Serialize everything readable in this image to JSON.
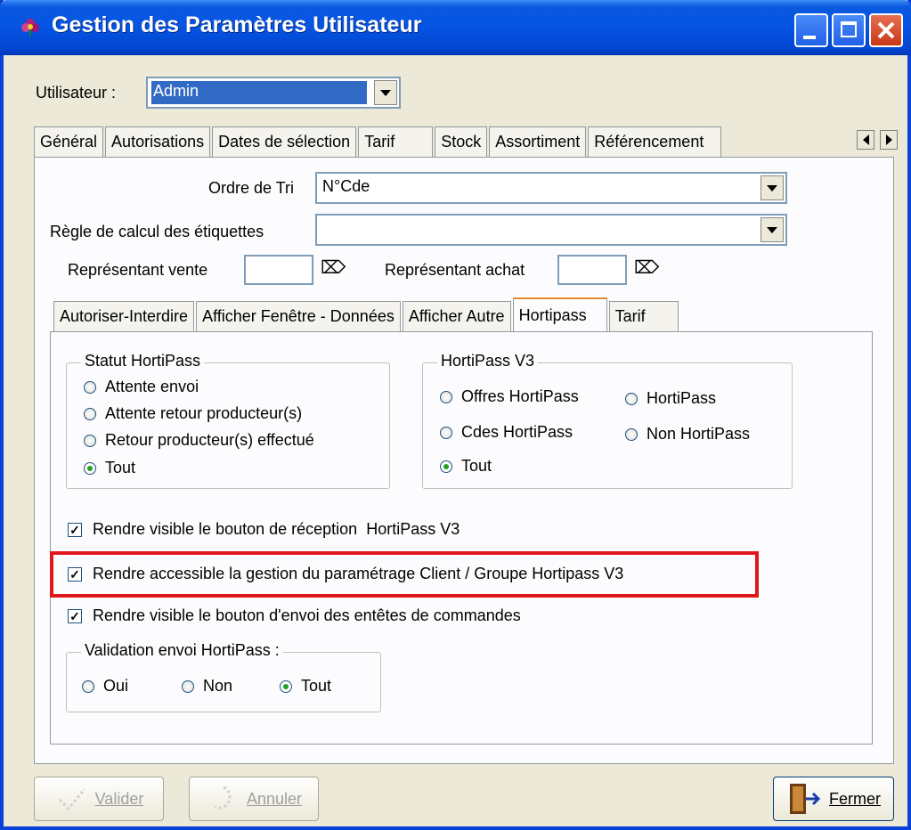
{
  "window": {
    "title": "Gestion des Paramètres Utilisateur"
  },
  "user": {
    "label": "Utilisateur :",
    "value": "Admin"
  },
  "main_tabs": [
    {
      "label": "Général"
    },
    {
      "label": "Autorisations"
    },
    {
      "label": "Dates de sélection"
    },
    {
      "label": "Tarif"
    },
    {
      "label": "Stock"
    },
    {
      "label": "Assortiment"
    },
    {
      "label": "Référencement"
    }
  ],
  "fields": {
    "ordre_tri_label": "Ordre de Tri",
    "ordre_tri_value": "N°Cde",
    "regle_label": "Règle de calcul des étiquettes",
    "regle_value": "",
    "rep_vente_label": "Représentant vente",
    "rep_achat_label": "Représentant achat"
  },
  "sub_tabs": [
    {
      "label": "Autoriser-Interdire"
    },
    {
      "label": "Afficher Fenêtre - Données"
    },
    {
      "label": "Afficher Autre"
    },
    {
      "label": "Hortipass"
    },
    {
      "label": "Tarif"
    }
  ],
  "statut_group": {
    "legend": "Statut HortiPass",
    "options": [
      "Attente envoi",
      "Attente retour producteur(s)",
      "Retour producteur(s) effectué",
      "Tout"
    ],
    "selected": "Tout"
  },
  "v3_group": {
    "legend": "HortiPass V3",
    "options": [
      "Offres HortiPass",
      "HortiPass",
      "Cdes HortiPass",
      "Non HortiPass",
      "Tout"
    ],
    "selected": "Tout"
  },
  "checkboxes": [
    {
      "label": "Rendre visible le bouton de réception  HortiPass V3",
      "checked": true
    },
    {
      "label": "Rendre accessible la gestion du paramétrage Client / Groupe Hortipass V3",
      "checked": true
    },
    {
      "label": "Rendre visible le bouton d'envoi des entêtes de commandes",
      "checked": true
    }
  ],
  "validation_group": {
    "legend": "Validation envoi HortiPass :",
    "options": [
      "Oui",
      "Non",
      "Tout"
    ],
    "selected": "Tout"
  },
  "buttons": {
    "valider": "Valider",
    "annuler": "Annuler",
    "fermer": "Fermer"
  },
  "colors": {
    "highlight": "#e0181c",
    "titlebar": "#0554e3"
  }
}
